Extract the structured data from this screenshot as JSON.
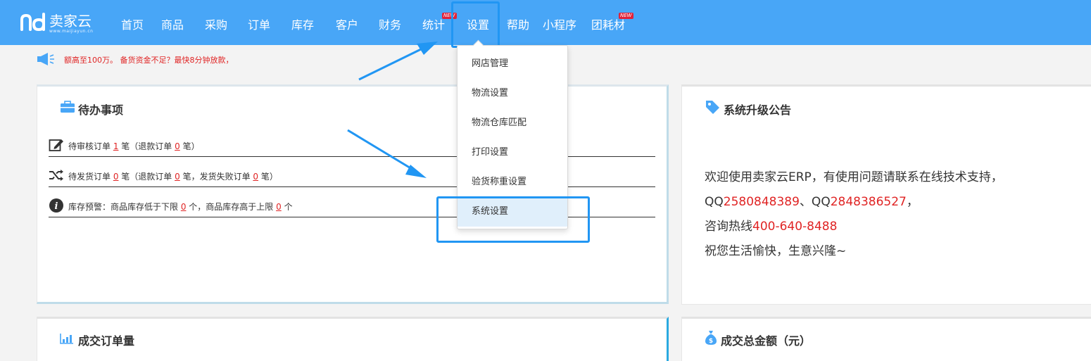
{
  "brand": {
    "name": "卖家云",
    "domain": "www.maijiayun.cn"
  },
  "nav": {
    "items": [
      {
        "label": "首页"
      },
      {
        "label": "商品"
      },
      {
        "label": "采购"
      },
      {
        "label": "订单"
      },
      {
        "label": "库存"
      },
      {
        "label": "客户"
      },
      {
        "label": "财务"
      },
      {
        "label": "统计",
        "badge": "NEW"
      },
      {
        "label": "设置",
        "selected": true
      },
      {
        "label": "帮助"
      },
      {
        "label": "小程序"
      },
      {
        "label": "团耗材",
        "badge": "NEW"
      }
    ]
  },
  "announcement": {
    "text": "额高至100万。 备货资金不足？最快8分钟放款，"
  },
  "dropdown": {
    "items": [
      {
        "label": "网店管理"
      },
      {
        "label": "物流设置"
      },
      {
        "label": "物流仓库匹配"
      },
      {
        "label": "打印设置"
      },
      {
        "label": "验货称重设置"
      },
      {
        "label": "系统设置",
        "selected": true
      }
    ]
  },
  "todo": {
    "title": "待办事项",
    "rows": [
      {
        "pre": "待审核订单 ",
        "n1": "1",
        "mid1": " 笔（退款订单 ",
        "n2": "0",
        "post": " 笔）"
      },
      {
        "pre": "待发货订单 ",
        "n1": "0",
        "mid1": " 笔（退款订单 ",
        "n2": "0",
        "mid2": " 笔，发货失败订单 ",
        "n3": "0",
        "post": " 笔）"
      },
      {
        "pre": "库存预警：商品库存低于下限 ",
        "n1": "0",
        "mid1": " 个，商品库存高于上限 ",
        "n2": "0",
        "post": " 个"
      }
    ]
  },
  "notice": {
    "title": "系统升级公告",
    "line1": "欢迎使用卖家云ERP，有使用问题请联系在线技术支持，",
    "qq_prefix": "QQ",
    "qq1": "2580848389",
    "qq_sep": "、QQ",
    "qq2": "2848386527",
    "qq_end": "，",
    "hotline_prefix": "咨询热线",
    "hotline": "400-640-8488",
    "line4": "祝您生活愉快，生意兴隆~"
  },
  "orders_card": {
    "title": "成交订单量"
  },
  "amount_card": {
    "title": "成交总金额（元）"
  },
  "colors": {
    "topbar": "#48a6f7",
    "highlight": "#2196f3",
    "alert_red": "#e02424"
  }
}
